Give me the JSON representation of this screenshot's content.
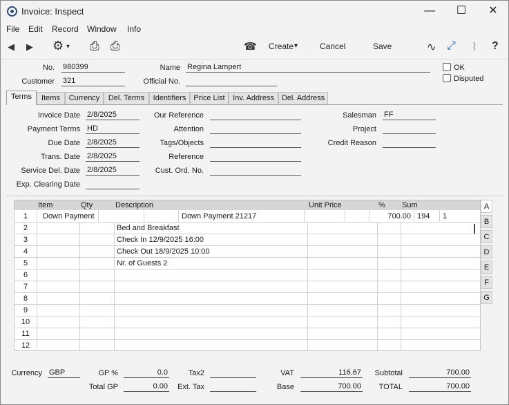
{
  "window": {
    "title": "Invoice: Inspect",
    "minimize": "—",
    "maximize": "☐",
    "close": "✕"
  },
  "menu": {
    "file": "File",
    "edit": "Edit",
    "record": "Record",
    "window": "Window",
    "info": "Info"
  },
  "toolbar": {
    "back_icon": "◀",
    "forward_icon": "▶",
    "gear_icon": "⚙",
    "dropdown_caret": "▾",
    "print_icon": "⎙",
    "preview_icon": "⎙",
    "phone_icon": "☎",
    "create_label": "Create",
    "cancel_label": "Cancel",
    "save_label": "Save",
    "activity_icon": "∿",
    "expand_icon": "⤢",
    "attach_icon": "⌇",
    "help_icon": "?"
  },
  "header": {
    "no_label": "No.",
    "no_value": "980399",
    "name_label": "Name",
    "name_value": "Regina Lampert",
    "customer_label": "Customer",
    "customer_value": "321",
    "official_no_label": "Official No.",
    "official_no_value": "",
    "ok_label": "OK",
    "disputed_label": "Disputed"
  },
  "tabs": [
    "Terms",
    "Items",
    "Currency",
    "Del. Terms",
    "Identifiers",
    "Price List",
    "Inv. Address",
    "Del. Address"
  ],
  "terms": {
    "invoice_date_label": "Invoice Date",
    "invoice_date": "2/8/2025",
    "payment_terms_label": "Payment Terms",
    "payment_terms": "HD",
    "due_date_label": "Due Date",
    "due_date": "2/8/2025",
    "trans_date_label": "Trans. Date",
    "trans_date": "2/8/2025",
    "service_del_date_label": "Service Del. Date",
    "service_del_date": "2/8/2025",
    "exp_clearing_date_label": "Exp. Clearing Date",
    "exp_clearing_date": "",
    "our_reference_label": "Our Reference",
    "attention_label": "Attention",
    "tags_label": "Tags/Objects",
    "reference_label": "Reference",
    "cust_ord_label": "Cust. Ord. No.",
    "salesman_label": "Salesman",
    "salesman": "FF",
    "project_label": "Project",
    "credit_reason_label": "Credit Reason"
  },
  "grid": {
    "headers": {
      "item": "Item",
      "qty": "Qty",
      "description": "Description",
      "unit_price": "Unit Price",
      "pct": "%",
      "sum": "Sum"
    },
    "row_numbers": [
      "1",
      "2",
      "3",
      "4",
      "5",
      "6",
      "7",
      "8",
      "9",
      "10",
      "11",
      "12"
    ],
    "row1": {
      "item": "Down Payment",
      "description": "Down Payment 21217",
      "sum": "700.00",
      "extra1": "194",
      "extra2": "1"
    },
    "descriptions": [
      "Bed and Breakfast",
      "Check In 12/9/2025  16:00",
      "Check Out 18/9/2025  10:00",
      "Nr. of Guests 2"
    ],
    "side_tabs": [
      "A",
      "B",
      "C",
      "D",
      "E",
      "F",
      "G"
    ]
  },
  "footer": {
    "currency_label": "Currency",
    "currency": "GBP",
    "gp_pct_label": "GP %",
    "gp_pct": "0.0",
    "total_gp_label": "Total GP",
    "total_gp": "0.00",
    "tax2_label": "Tax2",
    "tax2": "",
    "ext_tax_label": "Ext. Tax",
    "ext_tax": "",
    "vat_label": "VAT",
    "vat": "116.67",
    "base_label": "Base",
    "base": "700.00",
    "subtotal_label": "Subtotal",
    "subtotal": "700.00",
    "total_label": "TOTAL",
    "total": "700.00"
  }
}
